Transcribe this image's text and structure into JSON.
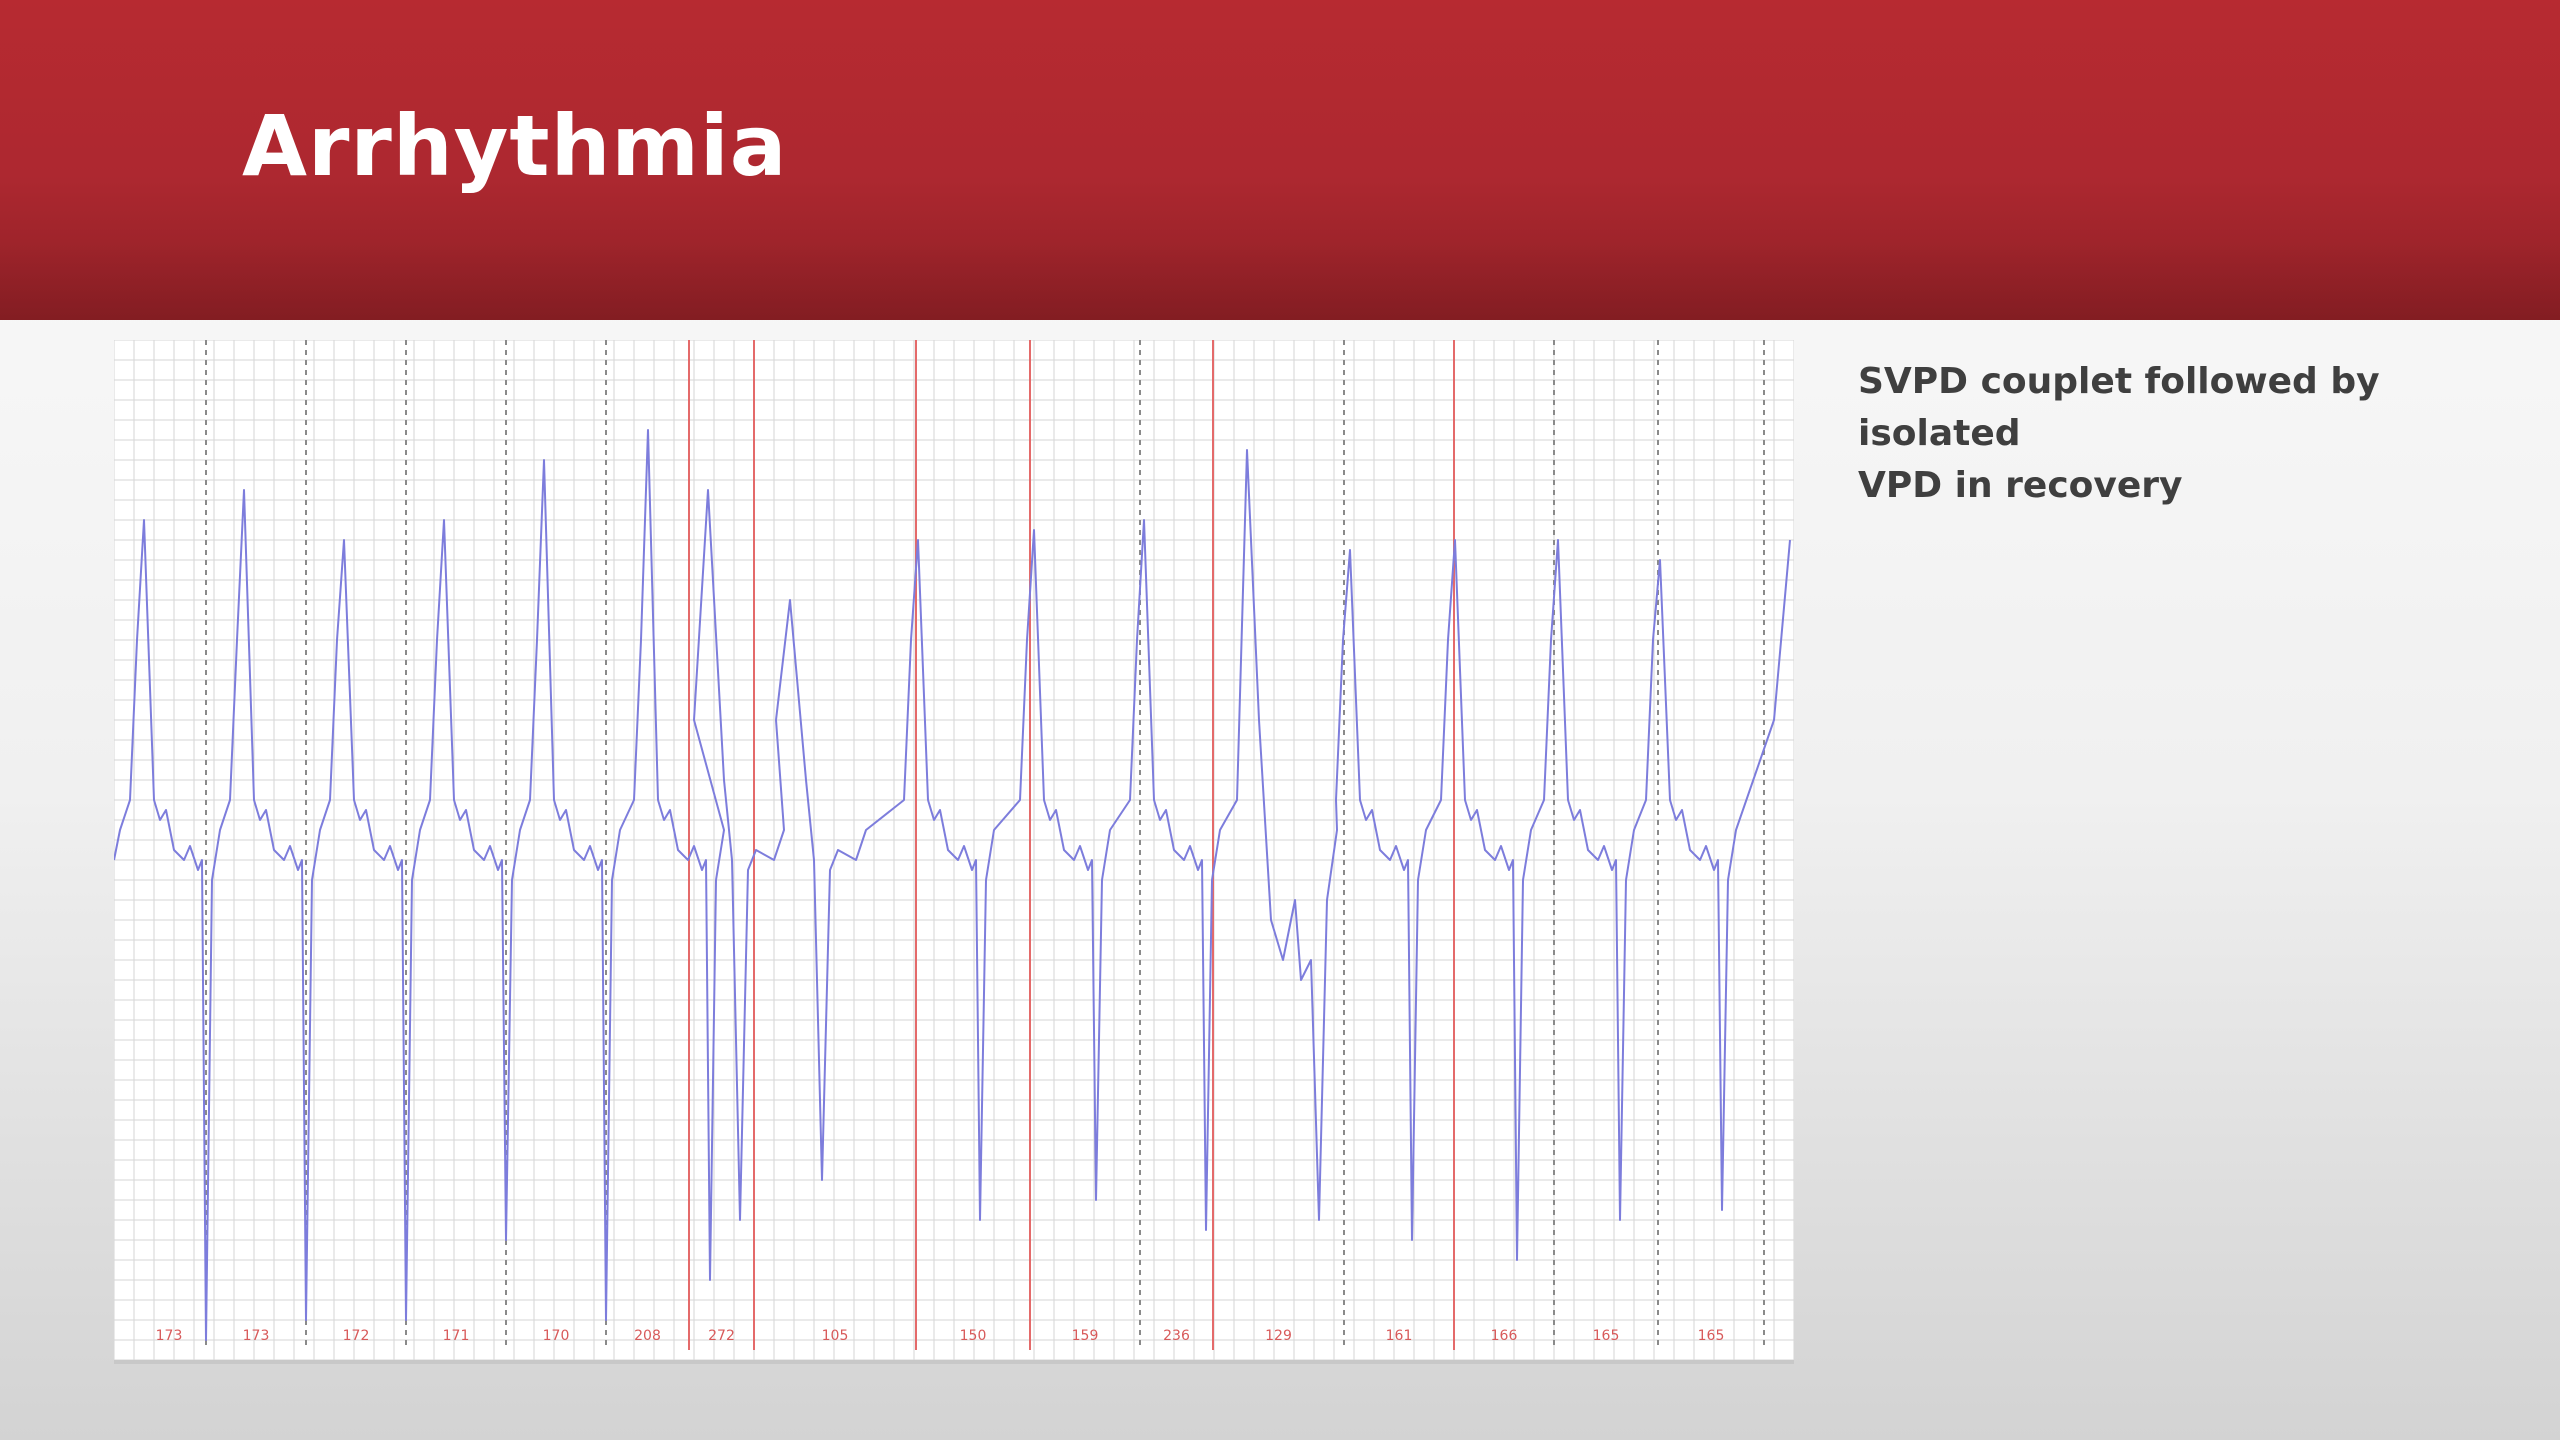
{
  "slide": {
    "title": "Arrhythmia",
    "caption_line1": "SVPD couplet followed by isolated",
    "caption_line2": "VPD in  recovery"
  },
  "colors": {
    "header": "#b0282f",
    "title_text": "#ffffff",
    "caption_text": "#3f3f3f",
    "ecg_trace": "#7d7ddc",
    "grid_line": "#d6d6d6",
    "marker_red": "#e46a6a",
    "marker_gray": "#8a8a8a",
    "rr_label": "#d85a5a"
  },
  "ecg": {
    "rr_labels": [
      "173",
      "173",
      "172",
      "171",
      "170",
      "208",
      "272",
      "105",
      "150",
      "159",
      "236",
      "129",
      "161",
      "166",
      "165",
      "165"
    ]
  }
}
